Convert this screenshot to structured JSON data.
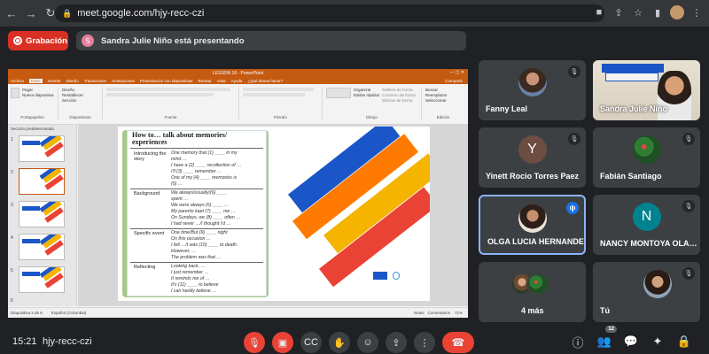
{
  "browser": {
    "url": "meet.google.com/hjy-recc-czi"
  },
  "meet": {
    "recording_label": "Grabación",
    "presenter_initial": "S",
    "presenting_text": "Sandra Julie Niño está presentando",
    "time": "15:21",
    "meeting_code": "hjy-recc-czi",
    "people_count": "12"
  },
  "powerpoint": {
    "title": "LESSON 16 - PowerPoint",
    "tabs": [
      "Archivo",
      "Inicio",
      "Insertar",
      "Diseño",
      "Transiciones",
      "Animaciones",
      "Presentación con diapositivas",
      "Revisar",
      "Vista",
      "Ayuda",
      "¿Qué desea hacer?"
    ],
    "share_label": "Compartir",
    "ribbon_groups": [
      "Portapapeles",
      "Diapositivas",
      "Fuente",
      "Párrafo",
      "Dibujo",
      "Edición"
    ],
    "ribbon_items": {
      "paste": "Pegar",
      "new_slide": "Nueva diapositiva",
      "layout": "Diseño",
      "reset": "Restablecer",
      "section": "Sección",
      "arrange": "Organizar",
      "quick_styles": "Estilos rápidos",
      "shape_fill": "Relleno de forma",
      "shape_outline": "Contorno de forma",
      "shape_effects": "Efectos de forma",
      "find": "Buscar",
      "replace": "Reemplazar",
      "select": "Seleccionar"
    },
    "section_label": "Sección predeterminada",
    "thumb_numbers": [
      "1",
      "2",
      "3",
      "4",
      "5",
      "6"
    ],
    "status_left": "Diapositiva 2 de 6",
    "status_lang": "Español (Colombia)",
    "status_notes": "Notas",
    "status_comments": "Comentarios",
    "zoom": "71%"
  },
  "slide": {
    "title_line1": "How to… talk about memories/",
    "title_line2": "experiences",
    "sections": [
      {
        "label": "Introducing the story",
        "lines": [
          "One memory that (1) ____ in my",
          "mind …",
          "I have a (2) ____ recollection of …",
          "I'll (3) ____ remember …",
          "One of my (4) ____ memories is",
          "(5) …"
        ]
      },
      {
        "label": "Background",
        "lines": [
          "We always/usually/(6) ____",
          "spent …",
          "We were always (6) ____ …",
          "My parents kept (7) ____ me …",
          "On Sundays, we (8) ____ often …",
          "I had never …/I thought I'd …"
        ]
      },
      {
        "label": "Specific event",
        "lines": [
          "One time/But (9) ____ night",
          "On this occasion …",
          "I felt …/I was (10) ____ to death.",
          "However, …",
          "The problem was that …"
        ]
      },
      {
        "label": "Reflecting",
        "lines": [
          "Looking back, …",
          "I just remember …",
          "It reminds me of …",
          "It's (11) ____ to believe",
          "I can hardly believe …"
        ]
      }
    ]
  },
  "participants": [
    {
      "name": "Fanny Leal"
    },
    {
      "name": "Sandra Julie Niño"
    },
    {
      "name": "Yinett Rocio Torres Paez",
      "initial": "Y"
    },
    {
      "name": "Fabián Santiago"
    },
    {
      "name": "OLGA LUCIA HERNANDE…"
    },
    {
      "name": "NANCY MONTOYA OLA…",
      "initial": "N"
    },
    {
      "name": "4 más"
    },
    {
      "name": "Tú"
    }
  ],
  "colors": {
    "recording": "#d93025",
    "powerpoint": "#c55a11",
    "active_border": "#8ab4f8",
    "avatar_y": "#6d4c41",
    "avatar_n": "#00838f"
  }
}
